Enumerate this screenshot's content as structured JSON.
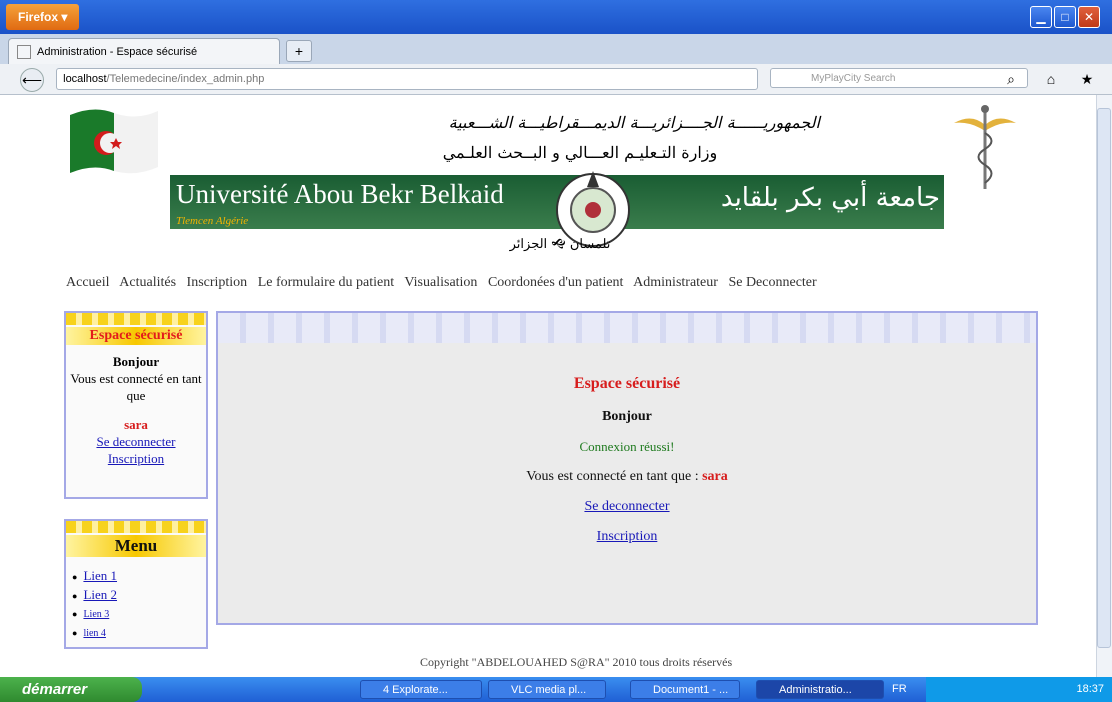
{
  "browser": {
    "menu_button": "Firefox",
    "tab_title": "Administration - Espace sécurisé",
    "url_host": "localhost",
    "url_path": "/Telemedecine/index_admin.php",
    "search_placeholder": "MyPlayCity Search"
  },
  "header": {
    "arabic_line1": "الجمهوريــــــة الجــــزائريـــة الديمـــقراطيـــة الشـــعبية",
    "arabic_line2": "وزارة التـعليـم العـــالي و البــحث العلـمي",
    "banner_fr": "Université Abou Bekr Belkaid",
    "banner_sub": "Tlemcen  Algérie",
    "banner_ar": "جامعة أبي بكر بلقايد",
    "banner_ar2": "تلمسان 🙝 الجزائر"
  },
  "nav": [
    "Accueil",
    "Actualités",
    "Inscription",
    "Le formulaire du patient",
    "Visualisation",
    "Coordonées d'un patient",
    "Administrateur",
    "Se Deconnecter"
  ],
  "sidebox1": {
    "title": "Espace sécurisé",
    "hello": "Bonjour",
    "connected_as": "Vous est connecté en tant que",
    "user": "sara",
    "logout": "Se deconnecter",
    "signup": "Inscription"
  },
  "sidebox2": {
    "title": "Menu",
    "links": [
      "Lien 1",
      "Lien 2",
      "Lien 3",
      "lien 4"
    ]
  },
  "main": {
    "title": "Espace sécurisé",
    "hello": "Bonjour",
    "success": "Connexion réussi!",
    "connected_as": "Vous est connecté en tant que :",
    "user": "sara",
    "logout": "Se deconnecter",
    "signup": "Inscription"
  },
  "footer": "Copyright \"ABDELOUAHED S@RA\" 2010 tous droits réservés",
  "taskbar": {
    "start": "démarrer",
    "tasks": [
      "4 Explorate...",
      "VLC media pl...",
      "Document1 - ...",
      "Administratio..."
    ],
    "lang": "FR",
    "clock": "18:37"
  },
  "colors": {
    "accent_red": "#d71d1d",
    "link_blue": "#1818b8",
    "box_border": "#a4a8e6",
    "banner_green": "#1a5d33"
  }
}
